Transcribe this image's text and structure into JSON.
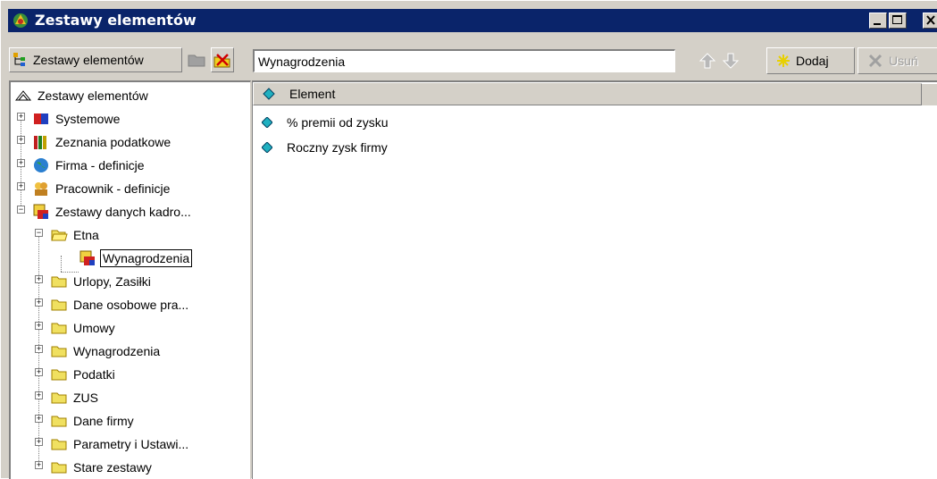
{
  "window": {
    "title": "Zestawy elementów",
    "titlebar_color": "#0a246a",
    "controls": [
      "minimize-icon",
      "maximize-icon",
      "close-icon"
    ]
  },
  "toolbar": {
    "sets_button_label": "Zestawy elementów",
    "folder_button": "folder-icon",
    "delete_set_button": "delete-x-icon",
    "name_value": "Wynagrodzenia",
    "up_button": "arrow-up-icon",
    "down_button": "arrow-down-icon",
    "add_label": "Dodaj",
    "remove_label": "Usuń"
  },
  "tree": {
    "root": "Zestawy elementów",
    "items": [
      {
        "label": "Systemowe",
        "icon": "system-set-icon"
      },
      {
        "label": "Zeznania podatkowe",
        "icon": "books-icon"
      },
      {
        "label": "Firma - definicje",
        "icon": "globe-icon"
      },
      {
        "label": "Pracownik - definicje",
        "icon": "people-icon"
      },
      {
        "label": "Zestawy danych kadro...",
        "icon": "data-set-icon"
      },
      {
        "label": "Etna",
        "icon": "folder-open-icon"
      },
      {
        "label": "Wynagrodzenia",
        "icon": "data-set-icon",
        "selected": true
      },
      {
        "label": "Urlopy, Zasiłki",
        "icon": "folder-icon"
      },
      {
        "label": "Dane osobowe pra...",
        "icon": "folder-icon"
      },
      {
        "label": "Umowy",
        "icon": "folder-icon"
      },
      {
        "label": "Wynagrodzenia",
        "icon": "folder-icon"
      },
      {
        "label": "Podatki",
        "icon": "folder-icon"
      },
      {
        "label": "ZUS",
        "icon": "folder-icon"
      },
      {
        "label": "Dane firmy",
        "icon": "folder-icon"
      },
      {
        "label": "Parametry i Ustawi...",
        "icon": "folder-icon"
      },
      {
        "label": "Stare zestawy",
        "icon": "folder-icon"
      }
    ]
  },
  "list": {
    "column_header": "Element",
    "rows": [
      {
        "label": "% premii od zysku"
      },
      {
        "label": "Roczny zysk firmy"
      }
    ]
  }
}
